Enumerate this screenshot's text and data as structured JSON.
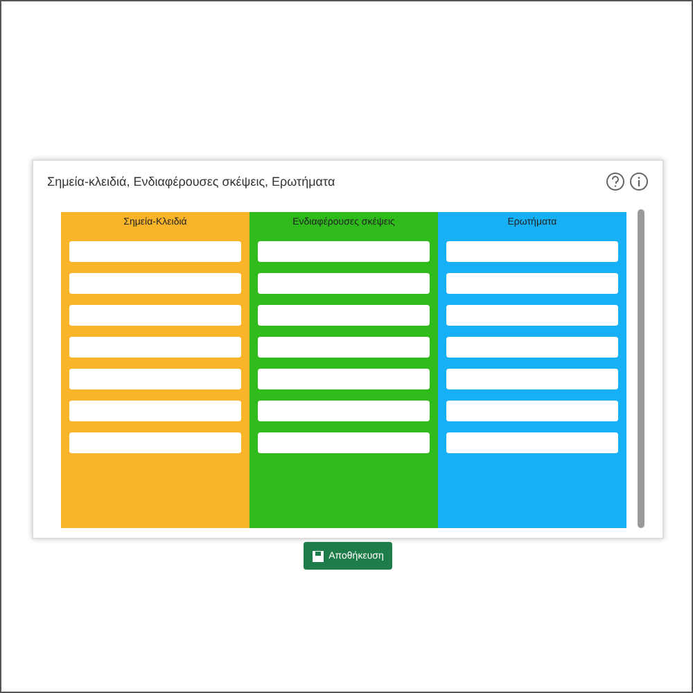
{
  "card": {
    "title": "Σημεία-κλειδιά, Ενδιαφέρουσες σκέψεις, Ερωτήματα"
  },
  "columns": [
    {
      "title": "Σημεία-Κλειδιά",
      "color": "#f9b429",
      "cells": [
        {
          "kind": "field"
        },
        {
          "kind": "field"
        },
        {
          "kind": "field"
        },
        {
          "kind": "field"
        },
        {
          "kind": "field"
        },
        {
          "kind": "field"
        },
        {
          "kind": "field"
        }
      ]
    },
    {
      "title": "Ενδιαφέρουσες σκέψεις",
      "color": "#2fbb1c",
      "cells": [
        {
          "kind": "field"
        },
        {
          "kind": "field"
        },
        {
          "kind": "field"
        },
        {
          "kind": "field"
        },
        {
          "kind": "field"
        },
        {
          "kind": "field"
        },
        {
          "kind": "field"
        }
      ]
    },
    {
      "title": "Ερωτήματα",
      "color": "#17b0f5",
      "cells": [
        {
          "kind": "field"
        },
        {
          "kind": "field"
        },
        {
          "kind": "field"
        },
        {
          "kind": "field"
        },
        {
          "kind": "field"
        },
        {
          "kind": "field"
        },
        {
          "kind": "field"
        }
      ]
    }
  ],
  "save_button": {
    "label": "Αποθήκευση"
  }
}
